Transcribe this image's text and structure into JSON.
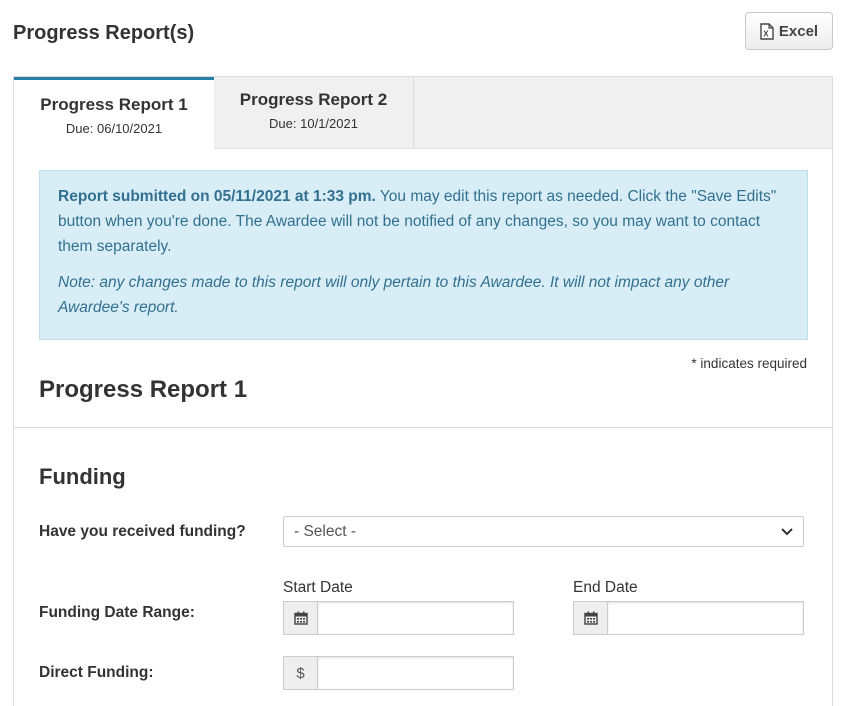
{
  "page": {
    "title": "Progress Report(s)"
  },
  "toolbar": {
    "excel_label": "Excel",
    "excel_icon": "excel-file-icon"
  },
  "tabs": [
    {
      "title": "Progress Report 1",
      "due": "Due: 06/10/2021",
      "active": true
    },
    {
      "title": "Progress Report 2",
      "due": "Due: 10/1/2021",
      "active": false
    }
  ],
  "alert": {
    "bold_text": "Report submitted on 05/11/2021 at 1:33 pm.",
    "body_text": " You may edit this report as needed. Click the \"Save Edits\" button when you're done. The Awardee will not be notified of any changes, so you may want to contact them separately.",
    "note_text": "Note: any changes made to this report will only pertain to this Awardee. It will not impact any other Awardee's report.",
    "background_color": "#d9edf7",
    "text_color": "#31708f"
  },
  "form": {
    "required_note": "* indicates required",
    "report_heading": "Progress Report 1",
    "section_heading": "Funding",
    "received_funding": {
      "label": "Have you received funding?",
      "value": "- Select -"
    },
    "date_range": {
      "label": "Funding Date Range:",
      "start_label": "Start Date",
      "start_value": "",
      "end_label": "End Date",
      "end_value": ""
    },
    "direct_funding": {
      "label": "Direct Funding:",
      "currency_symbol": "$",
      "value": ""
    }
  },
  "colors": {
    "active_tab_border": "#2a7fa5",
    "tab_bar_bg": "#f0f0f0"
  }
}
